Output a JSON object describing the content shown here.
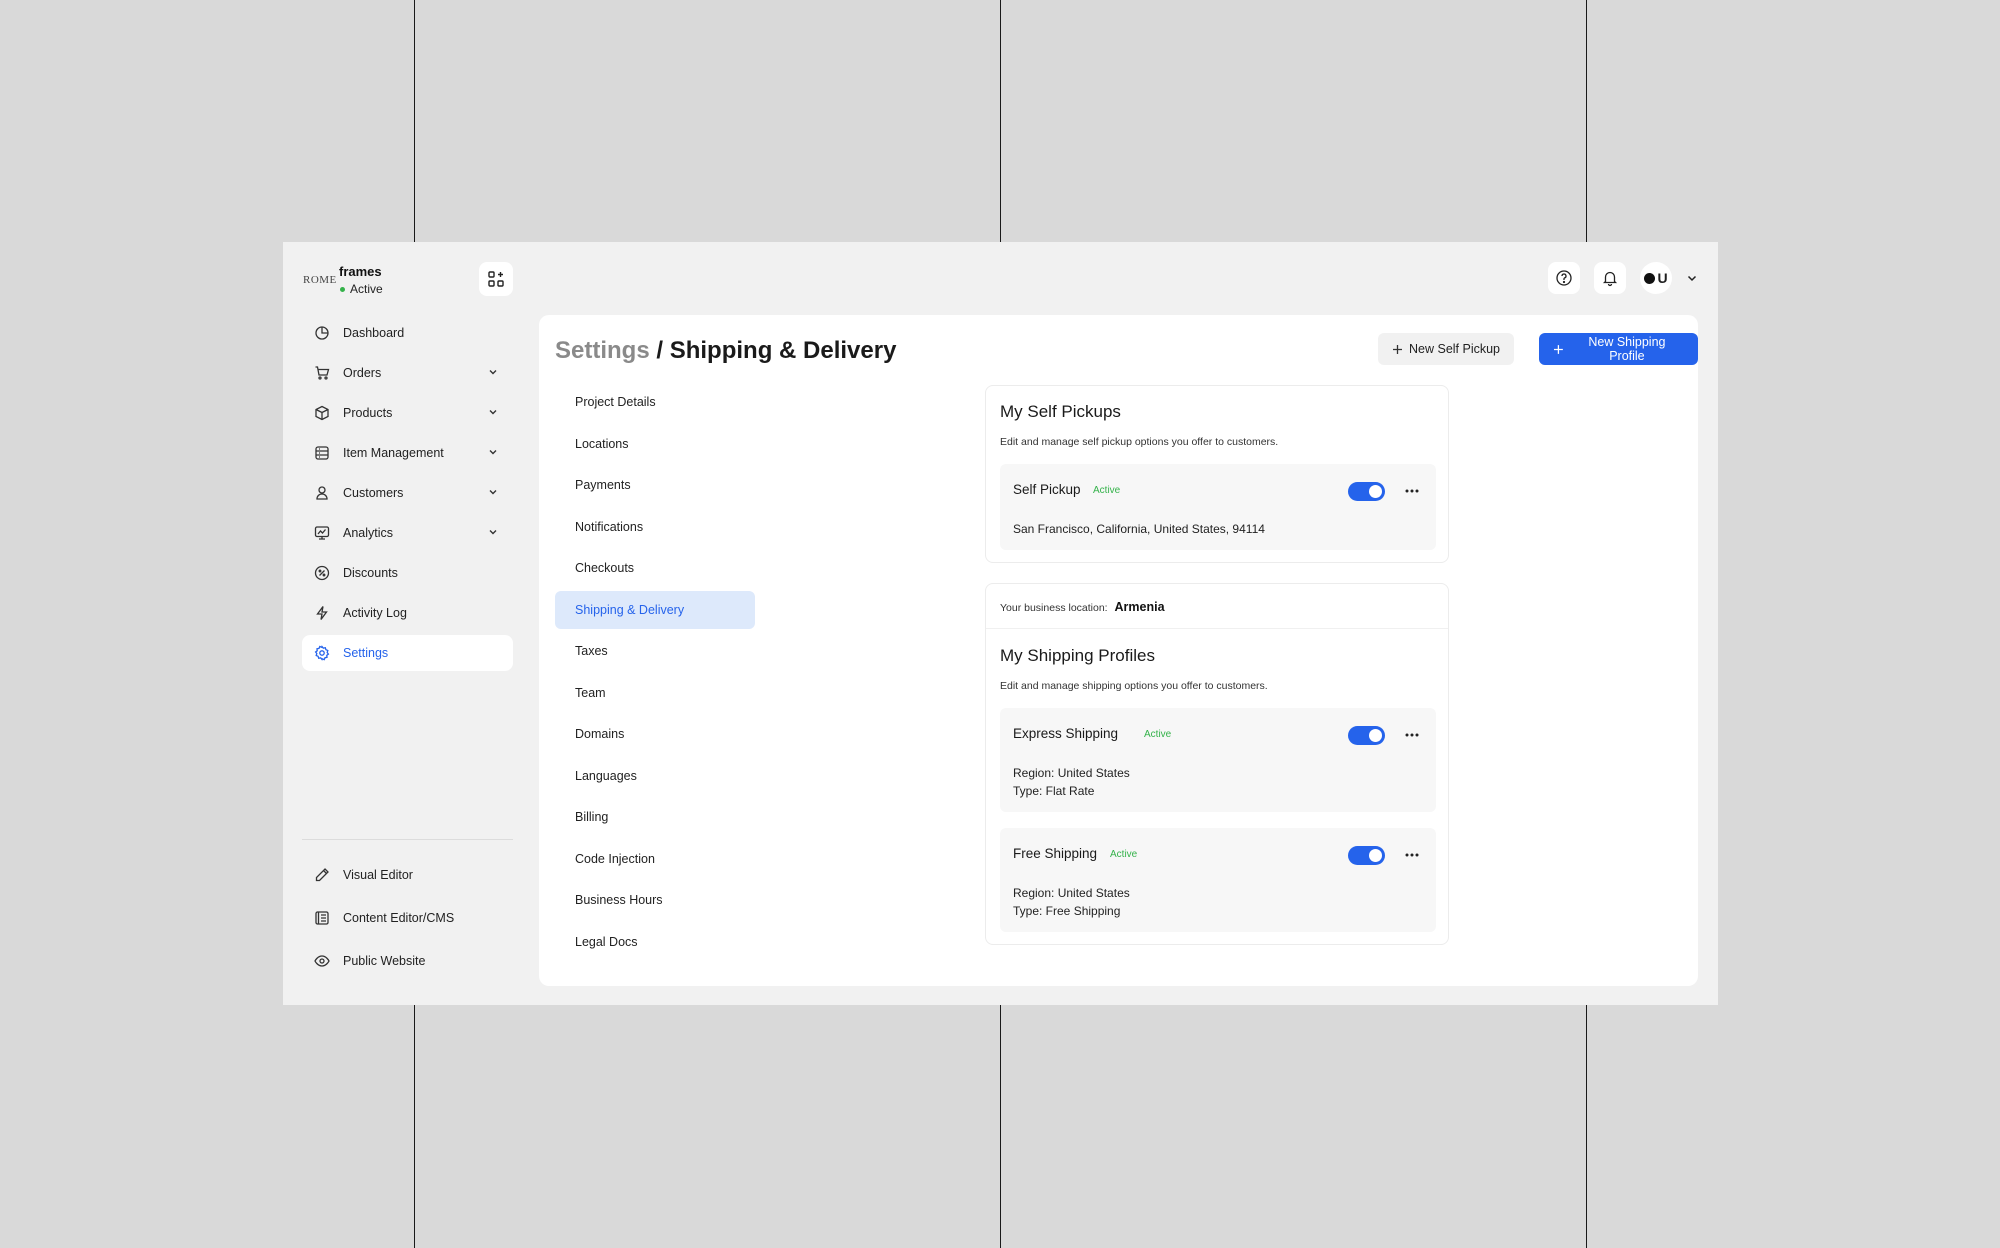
{
  "workspace": {
    "logo": "ROME",
    "name": "frames",
    "status": "Active"
  },
  "sidebar": {
    "items": [
      {
        "label": "Dashboard",
        "icon": "dashboard-icon"
      },
      {
        "label": "Orders",
        "icon": "cart-icon"
      },
      {
        "label": "Products",
        "icon": "box-icon"
      },
      {
        "label": "Item Management",
        "icon": "database-icon"
      },
      {
        "label": "Customers",
        "icon": "user-icon"
      },
      {
        "label": "Analytics",
        "icon": "monitor-chart-icon"
      },
      {
        "label": "Discounts",
        "icon": "discount-icon"
      },
      {
        "label": "Activity Log",
        "icon": "bolt-icon"
      },
      {
        "label": "Settings",
        "icon": "gear-icon"
      }
    ],
    "bottom_items": [
      {
        "label": "Visual Editor",
        "icon": "pencil-icon"
      },
      {
        "label": "Content Editor/CMS",
        "icon": "cms-icon"
      },
      {
        "label": "Public Website",
        "icon": "eye-icon"
      }
    ]
  },
  "header": {
    "avatar_label": "U"
  },
  "page": {
    "breadcrumb_parent": "Settings",
    "separator": "/",
    "title": "Shipping & Delivery",
    "new_self_pickup": "New Self Pickup",
    "new_shipping_profile": "New Shipping Profile"
  },
  "subnav": [
    "Project Details",
    "Locations",
    "Payments",
    "Notifications",
    "Checkouts",
    "Shipping & Delivery",
    "Taxes",
    "Team",
    "Domains",
    "Languages",
    "Billing",
    "Code Injection",
    "Business Hours",
    "Legal Docs"
  ],
  "self_pickups": {
    "title": "My Self Pickups",
    "description": "Edit and manage self pickup options you offer to customers.",
    "items": [
      {
        "name": "Self Pickup",
        "status": "Active",
        "address": "San Francisco, California, United States, 94114"
      }
    ]
  },
  "shipping": {
    "business_location_label": "Your business location:",
    "business_location_value": "Armenia",
    "title": "My Shipping Profiles",
    "description": "Edit and manage shipping options you offer to customers.",
    "profiles": [
      {
        "name": "Express Shipping",
        "status": "Active",
        "region": "Region: United States",
        "type": "Type: Flat Rate"
      },
      {
        "name": "Free Shipping",
        "status": "Active",
        "region": "Region: United States",
        "type": "Type: Free Shipping"
      }
    ]
  },
  "colors": {
    "accent": "#2563eb",
    "status_green": "#34b24a",
    "active_bg": "#dde9fb"
  }
}
